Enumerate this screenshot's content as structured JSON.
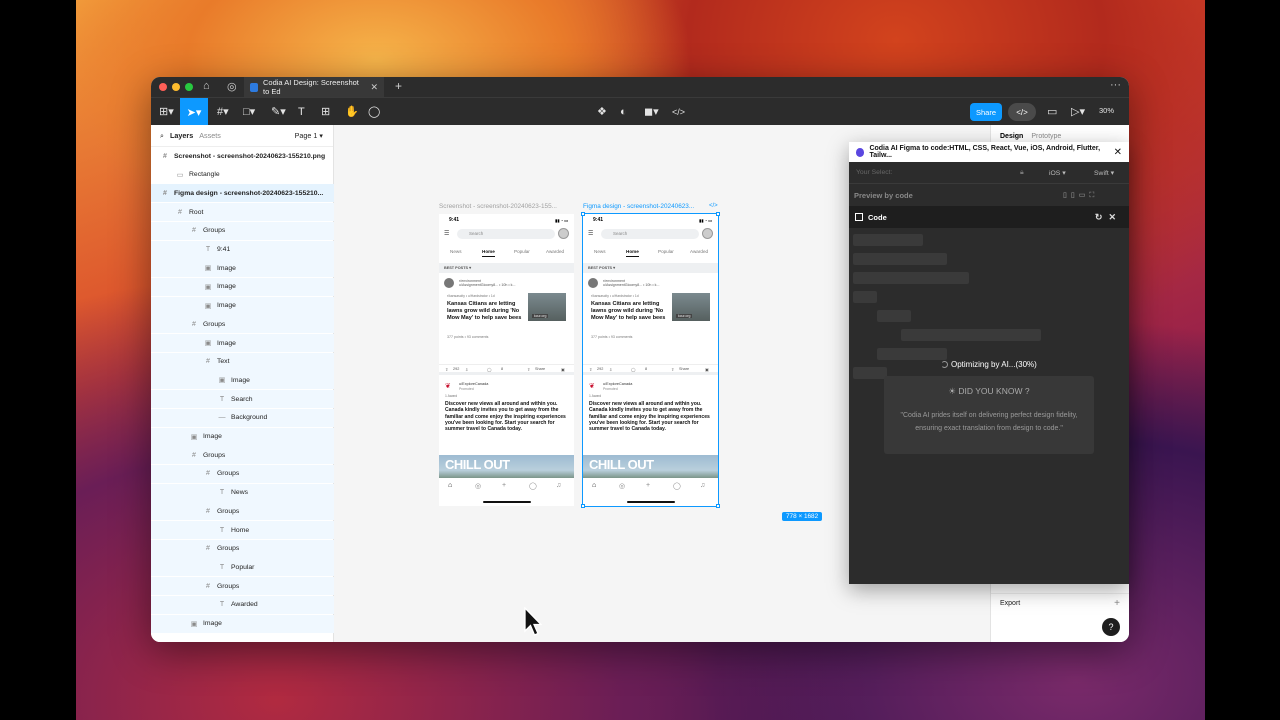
{
  "titlebar": {
    "tab_title": "Codia AI Design: Screenshot to Ed",
    "plus": "+",
    "more": "···"
  },
  "toolbar": {
    "share_label": "Share",
    "zoom_label": "30%"
  },
  "layers_panel": {
    "tab_layers": "Layers",
    "tab_assets": "Assets",
    "page_label": "Page 1",
    "items": [
      {
        "label": "Screenshot - screenshot-20240623-155210.png",
        "icon": "#",
        "bold": true
      },
      {
        "label": "Rectangle",
        "icon": "▭",
        "bold": false
      },
      {
        "label": "Figma design - screenshot-20240623-155210...",
        "icon": "#",
        "bold": true
      },
      {
        "label": "Root",
        "icon": "#",
        "bold": false
      },
      {
        "label": "Groups",
        "icon": "#",
        "bold": false
      },
      {
        "label": "9:41",
        "icon": "T",
        "bold": false
      },
      {
        "label": "Image",
        "icon": "▣",
        "bold": false
      },
      {
        "label": "Image",
        "icon": "▣",
        "bold": false
      },
      {
        "label": "Image",
        "icon": "▣",
        "bold": false
      },
      {
        "label": "Groups",
        "icon": "#",
        "bold": false
      },
      {
        "label": "Image",
        "icon": "▣",
        "bold": false
      },
      {
        "label": "Text",
        "icon": "#",
        "bold": false
      },
      {
        "label": "Image",
        "icon": "▣",
        "bold": false
      },
      {
        "label": "Search",
        "icon": "T",
        "bold": false
      },
      {
        "label": "Background",
        "icon": "—",
        "bold": false
      },
      {
        "label": "Image",
        "icon": "▣",
        "bold": false
      },
      {
        "label": "Groups",
        "icon": "#",
        "bold": false
      },
      {
        "label": "Groups",
        "icon": "#",
        "bold": false
      },
      {
        "label": "News",
        "icon": "T",
        "bold": false
      },
      {
        "label": "Groups",
        "icon": "#",
        "bold": false
      },
      {
        "label": "Home",
        "icon": "T",
        "bold": false
      },
      {
        "label": "Groups",
        "icon": "#",
        "bold": false
      },
      {
        "label": "Popular",
        "icon": "T",
        "bold": false
      },
      {
        "label": "Groups",
        "icon": "#",
        "bold": false
      },
      {
        "label": "Awarded",
        "icon": "T",
        "bold": false
      },
      {
        "label": "Image",
        "icon": "▣",
        "bold": false
      }
    ]
  },
  "right_panel": {
    "tab_design": "Design",
    "tab_prototype": "Prototype",
    "export_label": "Export",
    "help_label": "?"
  },
  "canvas": {
    "frame1_label": "Screenshot - screenshot-20240623-155...",
    "frame2_label": "Figma design - screenshot-20240623...",
    "dimensions": "778 × 1682",
    "phone": {
      "time": "9:41",
      "search": "Search",
      "tabs": [
        "News",
        "Home",
        "Popular",
        "Awarded"
      ],
      "sort": "BEST POSTS",
      "post1_user": "r/environment",
      "post1_meta": "u/AssignmentGloomy8... • 10h • k...",
      "post1_sub": "r/kansascity • u/Hardstr­ator • 1d",
      "post1_title": "Kansas Citians are letting lawns grow wild during 'No Mow May' to help save bees",
      "post1_thumb": "kcur.org",
      "post1_points": "377 points • 93 comments",
      "post1_votes": "292",
      "post1_comments": "8",
      "post1_share": "Share",
      "post2_user": "u/ExploreCanada",
      "post2_promo": "Promoted",
      "post2_award": "1 Award",
      "post2_body": "Discover new views all around and within you. Canada kindly invites you to get away from the familiar and come enjoy the inspiring experiences you've been looking for. Start your search for summer travel to Canada today.",
      "post2_banner": "CHILL OUT"
    }
  },
  "plugin": {
    "title": "Codia AI Figma to code:HTML, CSS, React, Vue, iOS, Android, Flutter, Tailw...",
    "selection_label": "Your Select:",
    "platform": "iOS",
    "language": "Swift",
    "preview_label": "Preview by code",
    "code_label": "Code",
    "status": "Optimizing by AI...(30%)",
    "tip_title": "DID YOU KNOW ?",
    "tip_text": "\"Codia AI prides itself on delivering perfect design fidelity, ensuring exact translation from design to code.\""
  }
}
